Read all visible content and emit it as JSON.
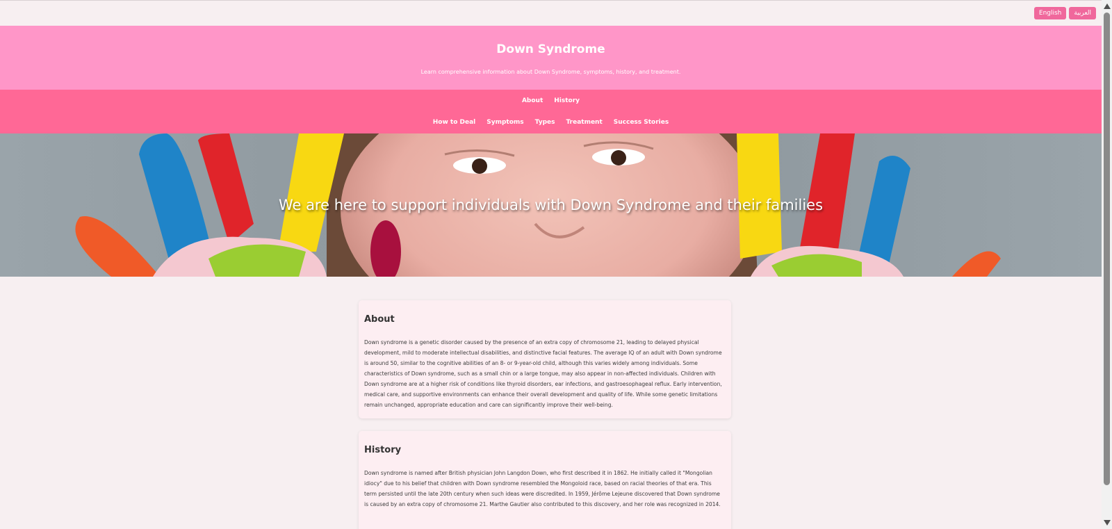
{
  "language_switcher": {
    "english_label": "English",
    "arabic_label": "العربية"
  },
  "header": {
    "title": "Down Syndrome",
    "subtitle": "Learn comprehensive information about Down Syndrome, symptoms, history, and treatment."
  },
  "nav": {
    "row1": [
      "About",
      "History"
    ],
    "row2": [
      "How to Deal",
      "Symptoms",
      "Types",
      "Treatment",
      "Success Stories"
    ]
  },
  "hero": {
    "tagline": "We are here to support individuals with Down Syndrome and their families"
  },
  "sections": {
    "about": {
      "title": "About",
      "text": "Down syndrome is a genetic disorder caused by the presence of an extra copy of chromosome 21, leading to delayed physical development, mild to moderate intellectual disabilities, and distinctive facial features. The average IQ of an adult with Down syndrome is around 50, similar to the cognitive abilities of an 8- or 9-year-old child, although this varies widely among individuals. Some characteristics of Down syndrome, such as a small chin or a large tongue, may also appear in non-affected individuals. Children with Down syndrome are at a higher risk of conditions like thyroid disorders, ear infections, and gastroesophageal reflux. Early intervention, medical care, and supportive environments can enhance their overall development and quality of life. While some genetic limitations remain unchanged, appropriate education and care can significantly improve their well-being."
    },
    "history": {
      "title": "History",
      "text": "Down syndrome is named after British physician John Langdon Down, who first described it in 1862. He initially called it \"Mongolian idiocy\" due to his belief that children with Down syndrome resembled the Mongoloid race, based on racial theories of that era. This term persisted until the late 20th century when such ideas were discredited. In 1959, Jérôme Lejeune discovered that Down syndrome is caused by an extra copy of chromosome 21. Marthe Gautier also contributed to this discovery, and her role was recognized in 2014."
    }
  },
  "colors": {
    "header_bg": "#ff96c8",
    "nav_bg": "#ff6896",
    "lang_button_bg": "#f0689c",
    "page_bg": "#f7eff1",
    "card_bg": "#fdeef2"
  }
}
